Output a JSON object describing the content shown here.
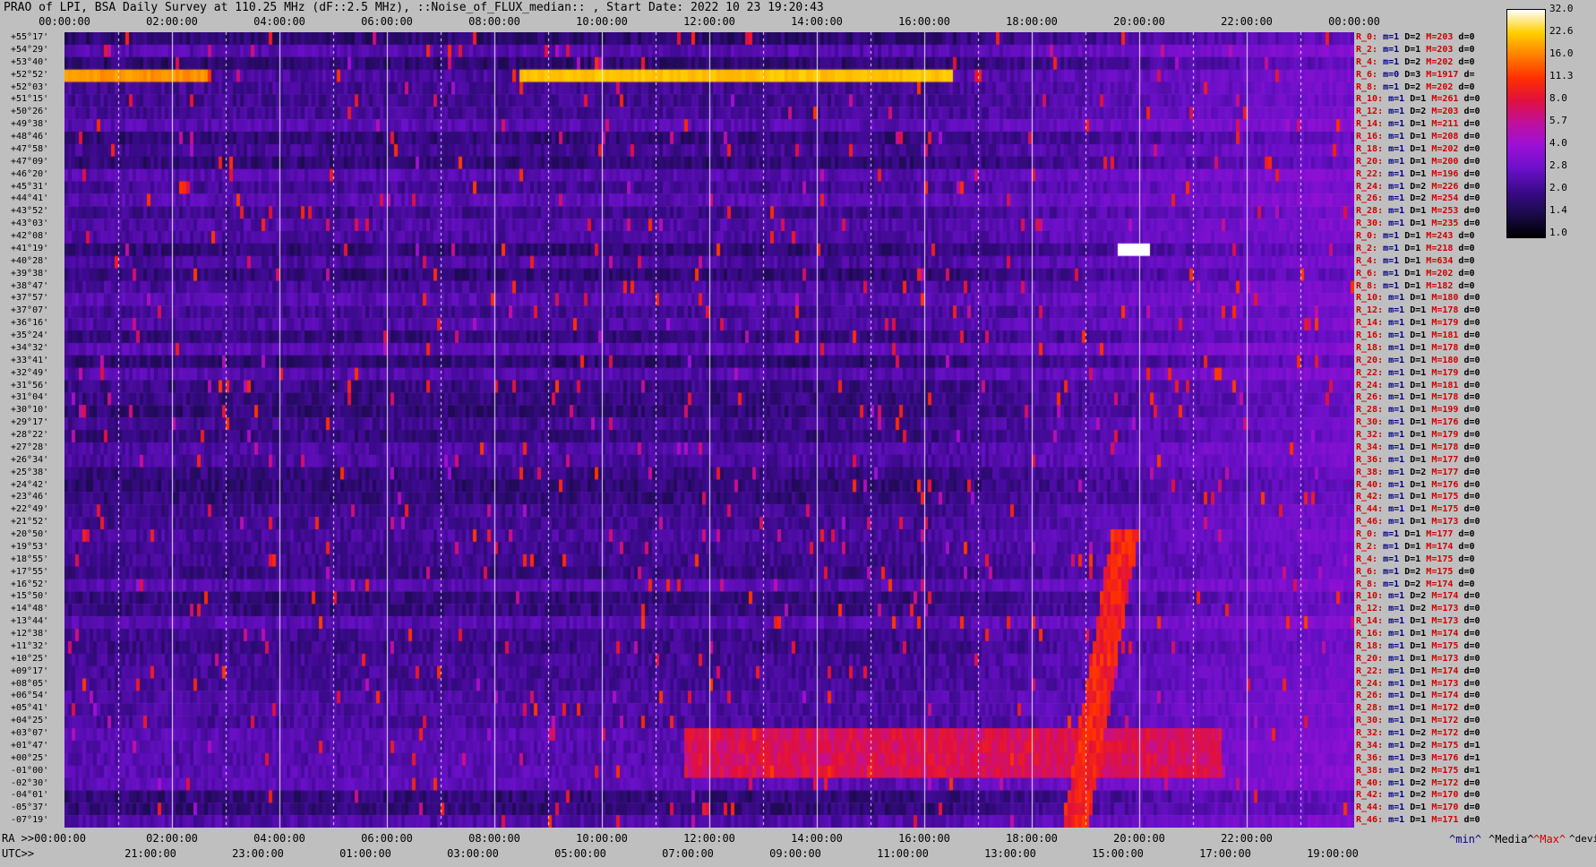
{
  "title": "PRAO of LPI, BSA Daily Survey at 110.25 MHz (dF::2.5 MHz), ::Noise_of_FLUX_median:: , Start Date: 2022 10 23 19:20:43",
  "x_axis_top": [
    "00:00:00",
    "02:00:00",
    "04:00:00",
    "06:00:00",
    "08:00:00",
    "10:00:00",
    "12:00:00",
    "14:00:00",
    "16:00:00",
    "18:00:00",
    "20:00:00",
    "22:00:00",
    "00:00:00"
  ],
  "x_axis_ra": [
    "RA >>00:00:00",
    "02:00:00",
    "04:00:00",
    "06:00:00",
    "08:00:00",
    "10:00:00",
    "12:00:00",
    "14:00:00",
    "16:00:00",
    "18:00:00",
    "20:00:00",
    "22:00:00"
  ],
  "x_axis_utc": [
    "UTC>>",
    "21:00:00",
    "23:00:00",
    "01:00:00",
    "03:00:00",
    "05:00:00",
    "07:00:00",
    "09:00:00",
    "11:00:00",
    "13:00:00",
    "15:00:00",
    "17:00:00",
    "19:00:00"
  ],
  "y_axis_dec": [
    "+55°17'",
    "+54°29'",
    "+53°40'",
    "+52°52'",
    "+52°03'",
    "+51°15'",
    "+50°26'",
    "+49°38'",
    "+48°46'",
    "+47°58'",
    "+47°09'",
    "+46°20'",
    "+45°31'",
    "+44°41'",
    "+43°52'",
    "+43°03'",
    "+42°08'",
    "+41°19'",
    "+40°28'",
    "+39°38'",
    "+38°47'",
    "+37°57'",
    "+37°07'",
    "+36°16'",
    "+35°24'",
    "+34°32'",
    "+33°41'",
    "+32°49'",
    "+31°56'",
    "+31°04'",
    "+30°10'",
    "+29°17'",
    "+28°22'",
    "+27°28'",
    "+26°34'",
    "+25°38'",
    "+24°42'",
    "+23°46'",
    "+22°49'",
    "+21°52'",
    "+20°50'",
    "+19°53'",
    "+18°55'",
    "+17°55'",
    "+16°52'",
    "+15°50'",
    "+14°48'",
    "+13°44'",
    "+12°38'",
    "+11°32'",
    "+10°25'",
    "+09°17'",
    "+08°05'",
    "+06°54'",
    "+05°41'",
    "+04°25'",
    "+03°07'",
    "+01°47'",
    "+00°25'",
    "-01°00'",
    "-02°30'",
    "-04°01'",
    "-05°37'",
    "-07°19'"
  ],
  "row_stats": [
    {
      "n": "R_0:",
      "min": "1",
      "med": "2",
      "max": "203",
      "dev": "0"
    },
    {
      "n": "R_2:",
      "min": "1",
      "med": "1",
      "max": "203",
      "dev": "0"
    },
    {
      "n": "R_4:",
      "min": "1",
      "med": "2",
      "max": "202",
      "dev": "0"
    },
    {
      "n": "R_6:",
      "min": "0",
      "med": "3",
      "max": "1917",
      "dev": ""
    },
    {
      "n": "R_8:",
      "min": "1",
      "med": "2",
      "max": "202",
      "dev": "0"
    },
    {
      "n": "R_10:",
      "min": "1",
      "med": "1",
      "max": "261",
      "dev": "0"
    },
    {
      "n": "R_12:",
      "min": "1",
      "med": "2",
      "max": "203",
      "dev": "0"
    },
    {
      "n": "R_14:",
      "min": "1",
      "med": "1",
      "max": "211",
      "dev": "0"
    },
    {
      "n": "R_16:",
      "min": "1",
      "med": "1",
      "max": "208",
      "dev": "0"
    },
    {
      "n": "R_18:",
      "min": "1",
      "med": "1",
      "max": "202",
      "dev": "0"
    },
    {
      "n": "R_20:",
      "min": "1",
      "med": "1",
      "max": "200",
      "dev": "0"
    },
    {
      "n": "R_22:",
      "min": "1",
      "med": "1",
      "max": "196",
      "dev": "0"
    },
    {
      "n": "R_24:",
      "min": "1",
      "med": "2",
      "max": "226",
      "dev": "0"
    },
    {
      "n": "R_26:",
      "min": "1",
      "med": "2",
      "max": "254",
      "dev": "0"
    },
    {
      "n": "R_28:",
      "min": "1",
      "med": "1",
      "max": "253",
      "dev": "0"
    },
    {
      "n": "R_30:",
      "min": "1",
      "med": "1",
      "max": "235",
      "dev": "0"
    },
    {
      "n": "R_0:",
      "min": "1",
      "med": "1",
      "max": "243",
      "dev": "0"
    },
    {
      "n": "R_2:",
      "min": "1",
      "med": "1",
      "max": "218",
      "dev": "0"
    },
    {
      "n": "R_4:",
      "min": "1",
      "med": "1",
      "max": "634",
      "dev": "0"
    },
    {
      "n": "R_6:",
      "min": "1",
      "med": "1",
      "max": "202",
      "dev": "0"
    },
    {
      "n": "R_8:",
      "min": "1",
      "med": "1",
      "max": "182",
      "dev": "0"
    },
    {
      "n": "R_10:",
      "min": "1",
      "med": "1",
      "max": "180",
      "dev": "0"
    },
    {
      "n": "R_12:",
      "min": "1",
      "med": "1",
      "max": "178",
      "dev": "0"
    },
    {
      "n": "R_14:",
      "min": "1",
      "med": "1",
      "max": "179",
      "dev": "0"
    },
    {
      "n": "R_16:",
      "min": "1",
      "med": "1",
      "max": "181",
      "dev": "0"
    },
    {
      "n": "R_18:",
      "min": "1",
      "med": "1",
      "max": "178",
      "dev": "0"
    },
    {
      "n": "R_20:",
      "min": "1",
      "med": "1",
      "max": "180",
      "dev": "0"
    },
    {
      "n": "R_22:",
      "min": "1",
      "med": "1",
      "max": "179",
      "dev": "0"
    },
    {
      "n": "R_24:",
      "min": "1",
      "med": "1",
      "max": "181",
      "dev": "0"
    },
    {
      "n": "R_26:",
      "min": "1",
      "med": "1",
      "max": "178",
      "dev": "0"
    },
    {
      "n": "R_28:",
      "min": "1",
      "med": "1",
      "max": "199",
      "dev": "0"
    },
    {
      "n": "R_30:",
      "min": "1",
      "med": "1",
      "max": "176",
      "dev": "0"
    },
    {
      "n": "R_32:",
      "min": "1",
      "med": "1",
      "max": "179",
      "dev": "0"
    },
    {
      "n": "R_34:",
      "min": "1",
      "med": "1",
      "max": "178",
      "dev": "0"
    },
    {
      "n": "R_36:",
      "min": "1",
      "med": "1",
      "max": "177",
      "dev": "0"
    },
    {
      "n": "R_38:",
      "min": "1",
      "med": "2",
      "max": "177",
      "dev": "0"
    },
    {
      "n": "R_40:",
      "min": "1",
      "med": "1",
      "max": "176",
      "dev": "0"
    },
    {
      "n": "R_42:",
      "min": "1",
      "med": "1",
      "max": "175",
      "dev": "0"
    },
    {
      "n": "R_44:",
      "min": "1",
      "med": "1",
      "max": "175",
      "dev": "0"
    },
    {
      "n": "R_46:",
      "min": "1",
      "med": "1",
      "max": "173",
      "dev": "0"
    },
    {
      "n": "R_0:",
      "min": "1",
      "med": "1",
      "max": "177",
      "dev": "0"
    },
    {
      "n": "R_2:",
      "min": "1",
      "med": "1",
      "max": "174",
      "dev": "0"
    },
    {
      "n": "R_4:",
      "min": "1",
      "med": "1",
      "max": "175",
      "dev": "0"
    },
    {
      "n": "R_6:",
      "min": "1",
      "med": "2",
      "max": "175",
      "dev": "0"
    },
    {
      "n": "R_8:",
      "min": "1",
      "med": "2",
      "max": "174",
      "dev": "0"
    },
    {
      "n": "R_10:",
      "min": "1",
      "med": "2",
      "max": "174",
      "dev": "0"
    },
    {
      "n": "R_12:",
      "min": "1",
      "med": "2",
      "max": "173",
      "dev": "0"
    },
    {
      "n": "R_14:",
      "min": "1",
      "med": "1",
      "max": "173",
      "dev": "0"
    },
    {
      "n": "R_16:",
      "min": "1",
      "med": "1",
      "max": "174",
      "dev": "0"
    },
    {
      "n": "R_18:",
      "min": "1",
      "med": "1",
      "max": "175",
      "dev": "0"
    },
    {
      "n": "R_20:",
      "min": "1",
      "med": "1",
      "max": "173",
      "dev": "0"
    },
    {
      "n": "R_22:",
      "min": "1",
      "med": "1",
      "max": "174",
      "dev": "0"
    },
    {
      "n": "R_24:",
      "min": "1",
      "med": "1",
      "max": "173",
      "dev": "0"
    },
    {
      "n": "R_26:",
      "min": "1",
      "med": "1",
      "max": "174",
      "dev": "0"
    },
    {
      "n": "R_28:",
      "min": "1",
      "med": "1",
      "max": "172",
      "dev": "0"
    },
    {
      "n": "R_30:",
      "min": "1",
      "med": "1",
      "max": "172",
      "dev": "0"
    },
    {
      "n": "R_32:",
      "min": "1",
      "med": "2",
      "max": "172",
      "dev": "0"
    },
    {
      "n": "R_34:",
      "min": "1",
      "med": "2",
      "max": "175",
      "dev": "1"
    },
    {
      "n": "R_36:",
      "min": "1",
      "med": "3",
      "max": "176",
      "dev": "1"
    },
    {
      "n": "R_38:",
      "min": "1",
      "med": "2",
      "max": "175",
      "dev": "1"
    },
    {
      "n": "R_40:",
      "min": "1",
      "med": "2",
      "max": "172",
      "dev": "0"
    },
    {
      "n": "R_42:",
      "min": "1",
      "med": "2",
      "max": "170",
      "dev": "0"
    },
    {
      "n": "R_44:",
      "min": "1",
      "med": "1",
      "max": "170",
      "dev": "0"
    },
    {
      "n": "R_46:",
      "min": "1",
      "med": "1",
      "max": "171",
      "dev": "0"
    }
  ],
  "row_stat_keys": {
    "min": "m=",
    "med": "D=",
    "max": "M=",
    "dev": "d="
  },
  "colorbar": {
    "ticks": [
      "32.0",
      "22.6",
      "16.0",
      "11.3",
      "8.0",
      "5.7",
      "4.0",
      "2.8",
      "2.0",
      "1.4",
      "1.0"
    ],
    "colors": [
      "#000000",
      "#1a0a4a",
      "#3a0a8a",
      "#6a10c8",
      "#9a10d8",
      "#c010a0",
      "#e01040",
      "#ff3000",
      "#ff8000",
      "#ffd000",
      "#ffffff"
    ]
  },
  "legend": {
    "min": "^min^",
    "med": "^Media^",
    "max": "^Max^",
    "dev": "^devia^"
  },
  "chart_data": {
    "type": "heatmap",
    "title": "PRAO of LPI, BSA Daily Survey at 110.25 MHz (dF::2.5 MHz), ::Noise_of_FLUX_median:: , Start Date: 2022 10 23 19:20:43",
    "x_range_hours": [
      0,
      24
    ],
    "rows": 64,
    "colormap_range": [
      1.0,
      32.0
    ],
    "scale": "log",
    "features": [
      {
        "desc": "bright horizontal band",
        "row": 3,
        "x_hours": [
          0,
          2.6
        ],
        "level": 16
      },
      {
        "desc": "bright horizontal band",
        "row": 3,
        "x_hours": [
          8.4,
          16.5
        ],
        "level": 20
      },
      {
        "desc": "strong source",
        "row": 17,
        "x_hours": [
          19.9
        ],
        "level": 32
      },
      {
        "desc": "enhanced band",
        "rows": [
          56,
          59
        ],
        "x_hours": [
          11.5,
          21.5
        ],
        "level": 6
      },
      {
        "desc": "drifting feature",
        "rows": [
          40,
          63
        ],
        "x_hours": [
          18.8,
          19.7
        ],
        "level": 8
      }
    ]
  }
}
